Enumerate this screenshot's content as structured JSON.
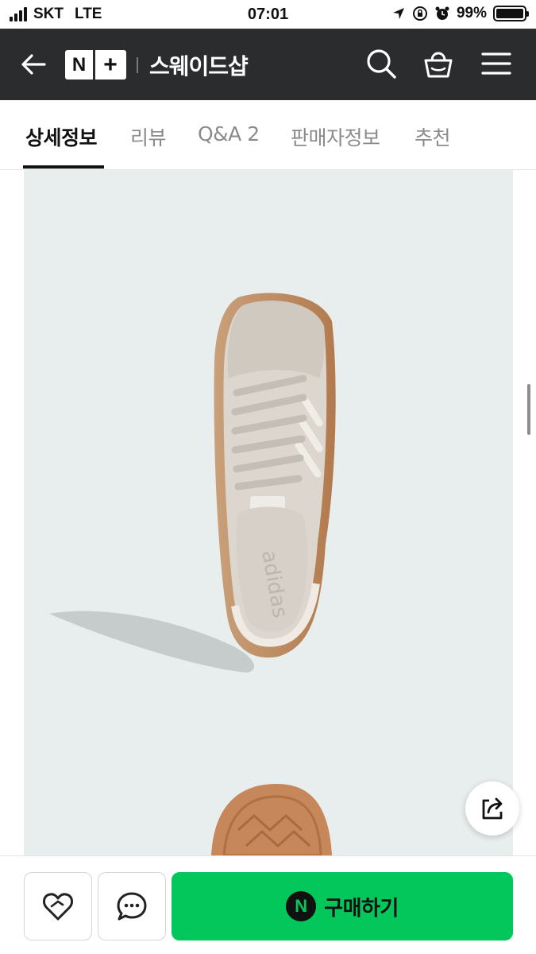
{
  "status_bar": {
    "carrier": "SKT",
    "network": "LTE",
    "time": "07:01",
    "battery": "99%",
    "battery_level": 0.99
  },
  "header": {
    "brand_n": "N",
    "brand_plus": "+",
    "store_name": "스웨이드샵",
    "icons": [
      "back-arrow-icon",
      "search-icon",
      "shopping-bag-icon",
      "menu-icon"
    ]
  },
  "tabs": [
    {
      "label": "상세정보",
      "active": true
    },
    {
      "label": "리뷰",
      "active": false
    },
    {
      "label": "Q&A 2",
      "active": false
    },
    {
      "label": "판매자정보",
      "active": false
    },
    {
      "label": "추천",
      "active": false
    }
  ],
  "product_image": {
    "logo_text": "adidas"
  },
  "bottom_bar": {
    "buy_icon": "N",
    "buy_label": "구매하기",
    "icons": [
      "heart-icon",
      "chat-icon"
    ]
  },
  "colors": {
    "header_bg": "#2b2c2e",
    "buy_green": "#03c75a",
    "image_bg": "#e8eded"
  }
}
